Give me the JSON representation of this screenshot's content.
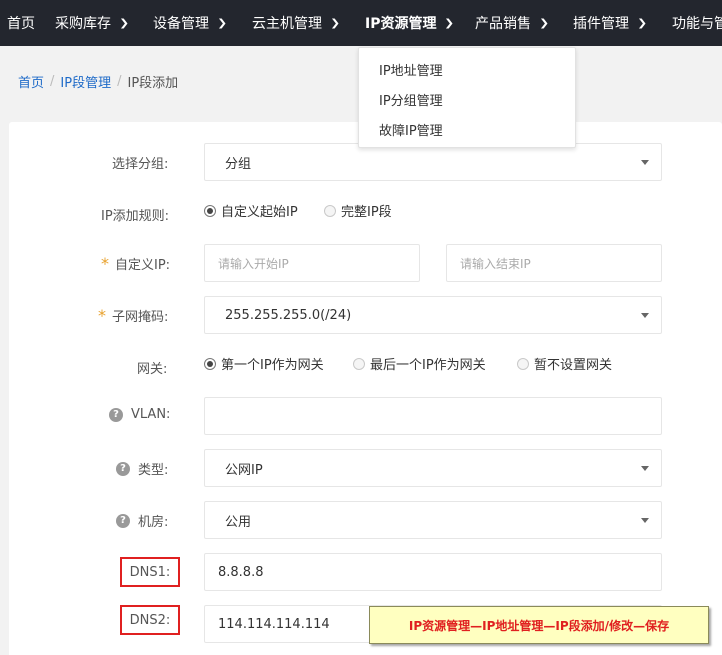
{
  "nav": {
    "items": [
      {
        "label": "首页",
        "has_chevron": false
      },
      {
        "label": "采购库存",
        "has_chevron": true
      },
      {
        "label": "设备管理",
        "has_chevron": true
      },
      {
        "label": "云主机管理",
        "has_chevron": true
      },
      {
        "label": "IP资源管理",
        "has_chevron": true,
        "active": true
      },
      {
        "label": "产品销售",
        "has_chevron": true
      },
      {
        "label": "插件管理",
        "has_chevron": true
      },
      {
        "label": "功能与管",
        "has_chevron": false
      }
    ]
  },
  "dropdown": {
    "items": [
      "IP地址管理",
      "IP分组管理",
      "故障IP管理"
    ]
  },
  "breadcrumb": {
    "home": "首页",
    "section": "IP段管理",
    "current": "IP段添加",
    "separator": "/"
  },
  "form": {
    "group": {
      "label": "选择分组:",
      "value": "分组"
    },
    "rule": {
      "label": "IP添加规则:",
      "options": [
        "自定义起始IP",
        "完整IP段"
      ],
      "selected": 0
    },
    "custom_ip": {
      "label": "自定义IP:",
      "start_placeholder": "请输入开始IP",
      "end_placeholder": "请输入结束IP",
      "required": "*"
    },
    "netmask": {
      "label": "子网掩码:",
      "value": "255.255.255.0(/24)",
      "required": "*"
    },
    "gateway": {
      "label": "网关:",
      "options": [
        "第一个IP作为网关",
        "最后一个IP作为网关",
        "暂不设置网关"
      ],
      "selected": 0
    },
    "vlan": {
      "label": "VLAN:",
      "value": ""
    },
    "type": {
      "label": "类型:",
      "value": "公网IP"
    },
    "room": {
      "label": "机房:",
      "value": "公用"
    },
    "dns1": {
      "label": "DNS1:",
      "value": "8.8.8.8"
    },
    "dns2": {
      "label": "DNS2:",
      "value": "114.114.114.114"
    }
  },
  "annotation": {
    "text": "IP资源管理—IP地址管理—IP段添加/修改—保存"
  },
  "icons": {
    "help": "?",
    "chevron": "chevron-down-icon"
  },
  "colors": {
    "nav_bg": "#23262e",
    "link": "#1e6ac8",
    "required": "#e8a12c",
    "highlight_border": "#e02020",
    "note_bg": "#ffffc0"
  }
}
